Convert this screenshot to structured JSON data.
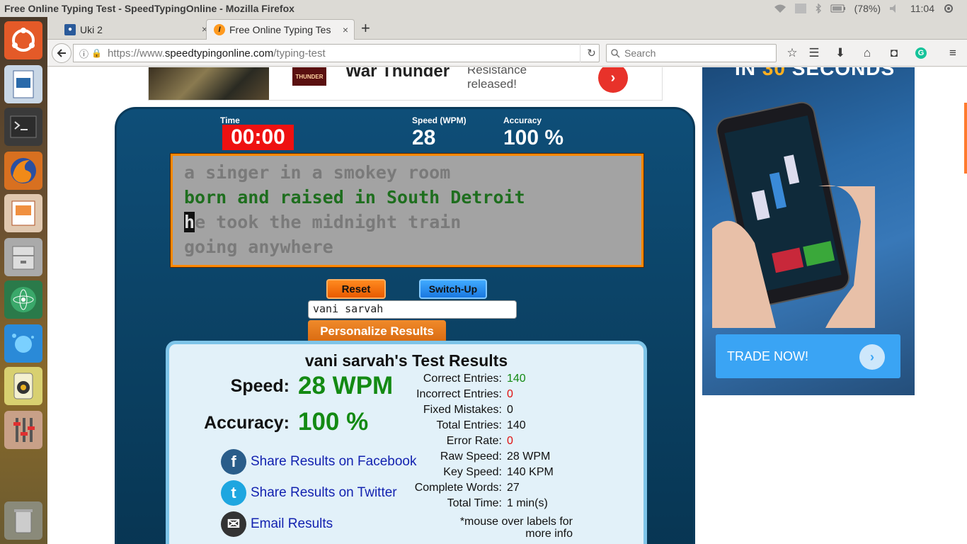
{
  "os": {
    "window_title": "Free Online Typing Test - SpeedTypingOnline - Mozilla Firefox",
    "battery": "(78%)",
    "clock": "11:04"
  },
  "browser": {
    "tabs": [
      {
        "label": "Uki 2",
        "close": "×"
      },
      {
        "label": "Free Online Typing Tes",
        "close": "×"
      }
    ],
    "new_tab": "+",
    "url_scheme": "https://www.",
    "url_domain": "speedtypingonline.com",
    "url_path": "/typing-test",
    "search_placeholder": "Search"
  },
  "top_ad": {
    "logo_text": "THUNDER",
    "title": "War Thunder",
    "text": "Resistance released!",
    "arrow": "›"
  },
  "typing_test": {
    "time_label": "Time",
    "time_value": "00:00",
    "speed_label": "Speed (WPM)",
    "speed_value": "28",
    "accuracy_label": "Accuracy",
    "accuracy_value": "100 %",
    "lines": [
      "a singer in a smokey room",
      "born and raised in South Detroit",
      "he took the midnight train",
      "going anywhere"
    ],
    "cursor_char": "h",
    "line3_rest": "e took the midnight train",
    "reset_label": "Reset",
    "switch_label": "Switch-Up",
    "name_value": "vani sarvah",
    "personalize_label": "Personalize Results"
  },
  "results": {
    "title": "vani sarvah's Test Results",
    "speed_label": "Speed:",
    "speed_value": "28 WPM",
    "accuracy_label": "Accuracy:",
    "accuracy_value": "100 %",
    "share_facebook": "Share Results on Facebook",
    "share_twitter": "Share Results on Twitter",
    "email": "Email Results",
    "details": [
      {
        "label": "Correct Entries:",
        "value": "140",
        "color": "#138a13"
      },
      {
        "label": "Incorrect Entries:",
        "value": "0",
        "color": "#e01010"
      },
      {
        "label": "Fixed Mistakes:",
        "value": "0",
        "color": "#111111"
      },
      {
        "label": "Total Entries:",
        "value": "140",
        "color": "#111111"
      },
      {
        "label": "Error Rate:",
        "value": "0",
        "color": "#e01010"
      },
      {
        "label": "Raw Speed:",
        "value": "28 WPM",
        "color": "#111111"
      },
      {
        "label": "Key Speed:",
        "value": "140 KPM",
        "color": "#111111"
      },
      {
        "label": "Complete Words:",
        "value": "27",
        "color": "#111111"
      },
      {
        "label": "Total Time:",
        "value": "1 min(s)",
        "color": "#111111"
      }
    ],
    "note": "*mouse over labels for more info"
  },
  "right_ad": {
    "headline_a": "IN ",
    "headline_b": "30",
    "headline_c": " SECONDS",
    "button": "TRADE NOW!",
    "arrow": "›"
  },
  "colors": {
    "accent_green": "#138a13",
    "error_red": "#e01010",
    "link_blue": "#1322b0",
    "panel_blue": "#0c4468",
    "orange": "#ff8800"
  }
}
